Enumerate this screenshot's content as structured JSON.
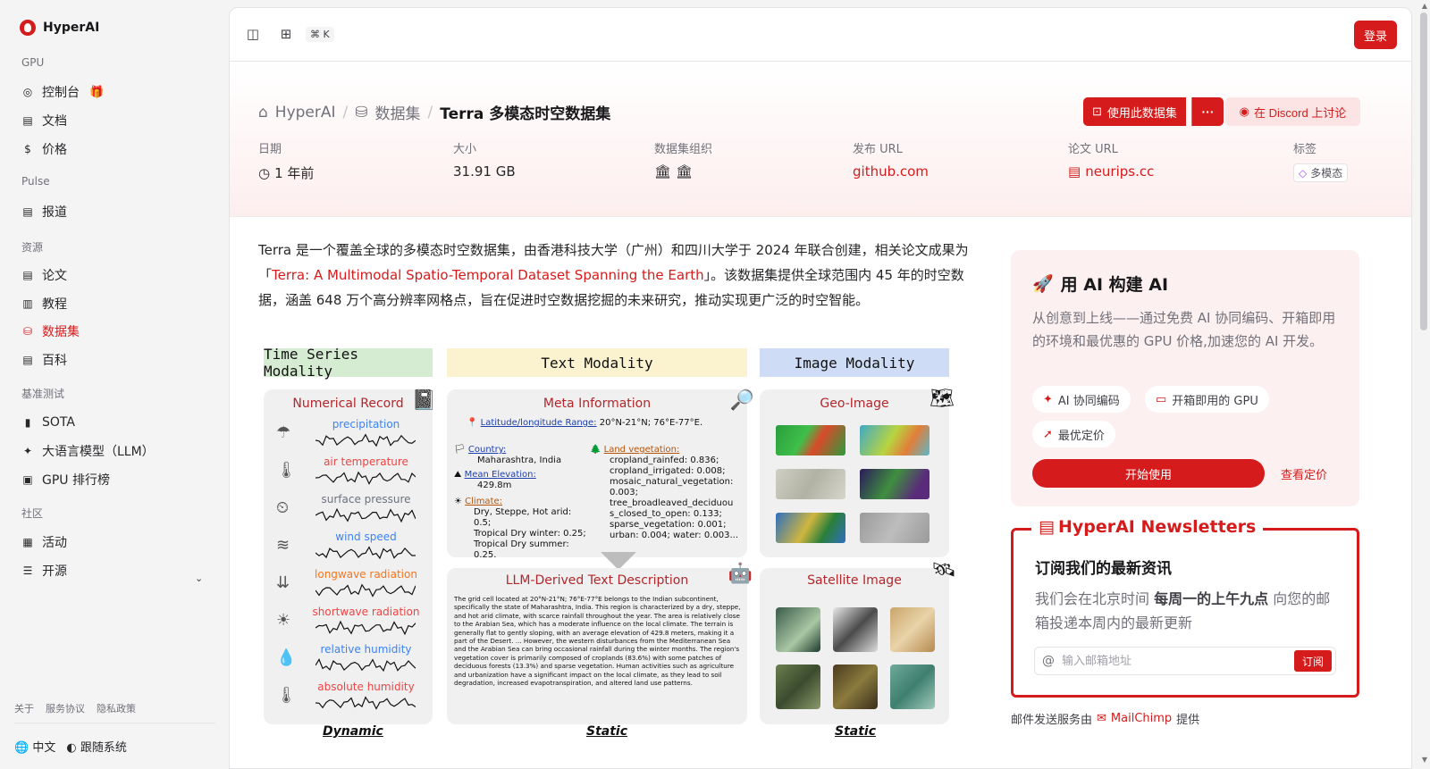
{
  "app": {
    "name": "HyperAI"
  },
  "sidebar": {
    "sections": [
      {
        "title": "GPU",
        "items": [
          {
            "label": "控制台",
            "icon": "gauge-icon"
          },
          {
            "label": "文档",
            "icon": "doc-icon"
          },
          {
            "label": "价格",
            "icon": "dollar-icon"
          }
        ]
      },
      {
        "title": "Pulse",
        "items": [
          {
            "label": "报道",
            "icon": "news-icon"
          }
        ]
      },
      {
        "title": "资源",
        "items": [
          {
            "label": "论文",
            "icon": "paper-icon"
          },
          {
            "label": "教程",
            "icon": "book-icon"
          },
          {
            "label": "数据集",
            "icon": "database-icon",
            "active": true
          },
          {
            "label": "百科",
            "icon": "wiki-icon"
          }
        ]
      },
      {
        "title": "基准测试",
        "items": [
          {
            "label": "SOTA",
            "icon": "chart-icon"
          },
          {
            "label": "大语言模型（LLM）",
            "icon": "sparkle-icon"
          },
          {
            "label": "GPU 排行榜",
            "icon": "cpu-icon"
          }
        ]
      },
      {
        "title": "社区",
        "items": [
          {
            "label": "活动",
            "icon": "calendar-icon"
          },
          {
            "label": "开源",
            "icon": "list-icon"
          }
        ]
      }
    ],
    "footer_links": [
      "关于",
      "服务协议",
      "隐私政策"
    ],
    "language": "中文",
    "tracking": "跟随系统"
  },
  "topbar": {
    "shortcut": "⌘ K",
    "login_label": "登录"
  },
  "breadcrumb": {
    "root": "HyperAI",
    "section": "数据集",
    "current": "Terra 多模态时空数据集"
  },
  "actions": {
    "use_label": "使用此数据集",
    "more_label": "···",
    "discord_label": "在 Discord 上讨论"
  },
  "meta": {
    "date_label": "日期",
    "date_value": "1 年前",
    "size_label": "大小",
    "size_value": "31.91 GB",
    "org_label": "数据集组织",
    "url_label": "发布 URL",
    "url_value": "github.com",
    "paper_label": "论文 URL",
    "paper_value": "neurips.cc",
    "tag_label": "标签",
    "tag_value": "多模态"
  },
  "description": {
    "part1": "Terra 是一个覆盖全球的多模态时空数据集，由香港科技大学（广州）和四川大学于 2024 年联合创建，相关论文成果为「",
    "link": "Terra: A Multimodal Spatio-Temporal Dataset Spanning the Earth",
    "part2": "」。该数据集提供全球范围内 45 年的时空数据，涵盖 648 万个高分辨率网格点，旨在促进时空数据挖掘的未来研究，推动实现更广泛的时空智能。"
  },
  "figure": {
    "col1_title": "Time Series Modality",
    "col2_title": "Text Modality",
    "col3_title": "Image Modality",
    "numerical_title": "Numerical Record",
    "series": [
      "precipitation",
      "air temperature",
      "surface pressure",
      "wind speed",
      "longwave radiation",
      "shortwave radiation",
      "relative humidity",
      "absolute humidity"
    ],
    "meta_title": "Meta Information",
    "latlon_label": "Latitude/longitude Range:",
    "latlon_value": "20°N-21°N; 76°E-77°E.",
    "country_label": "Country:",
    "country_value": "Maharashtra, India",
    "elev_label": "Mean Elevation:",
    "elev_value": "429.8m",
    "climate_label": "Climate:",
    "climate_lines": [
      "Dry, Steppe, Hot arid: 0.5;",
      "Tropical Dry winter: 0.25;",
      "Tropical Dry summer: 0.25."
    ],
    "veg_label": "Land vegetation:",
    "veg_lines": [
      "cropland_rainfed: 0.836;",
      "cropland_irrigated: 0.008;",
      "mosaic_natural_vegetation:",
      "0.003;",
      "tree_broadleaved_deciduou",
      "s_closed_to_open: 0.133;",
      "sparse_vegetation: 0.001;",
      "urban: 0.004; water: 0.003..."
    ],
    "llm_title": "LLM-Derived Text Description",
    "llm_text": "The grid cell located at 20°N-21°N; 76°E-77°E belongs to the Indian subcontinent, specifically the state of Maharashtra, India. This region is characterized by a dry, steppe, and hot arid climate, with scarce rainfall throughout the year. The area is relatively close to the Arabian Sea, which has a moderate influence on the local climate. The terrain is generally flat to gently sloping, with an average elevation of 429.8 meters, making it a part of the Desert. ... However, the western disturbances from the Mediterranean Sea and the Arabian Sea can bring occasional rainfall during the winter months. The region's vegetation cover is primarily composed of croplands (83.6%) with some patches of deciduous forests (13.3%) and sparse vegetation. Human activities such as agriculture and urbanization have a significant impact on the local climate, as they lead to soil degradation, increased evapotranspiration, and altered land use patterns.",
    "geo_title": "Geo-Image",
    "sat_title": "Satellite Image",
    "foot_dynamic": "Dynamic",
    "foot_static1": "Static",
    "foot_static2": "Static"
  },
  "promo": {
    "title": "用 AI 构建 AI",
    "desc": "从创意到上线——通过免费 AI 协同编码、开箱即用的环境和最优惠的 GPU 价格,加速您的 AI 开发。",
    "chips": [
      "AI 协同编码",
      "开箱即用的 GPU",
      "最优定价"
    ],
    "start_label": "开始使用",
    "pricing_label": "查看定价"
  },
  "newsletter": {
    "title": "HyperAI Newsletters",
    "subtitle": "订阅我们的最新资讯",
    "desc_pre": "我们会在北京时间 ",
    "desc_bold": "每周一的上午九点",
    "desc_post": " 向您的邮箱投递本周内的最新更新",
    "placeholder": "输入邮箱地址",
    "subscribe_label": "订阅",
    "mc_pre": "邮件发送服务由",
    "mc_link": "MailChimp",
    "mc_post": "提供"
  },
  "colors": {
    "accent": "#d51b1b",
    "promo_bg": "#fdf0f0"
  }
}
